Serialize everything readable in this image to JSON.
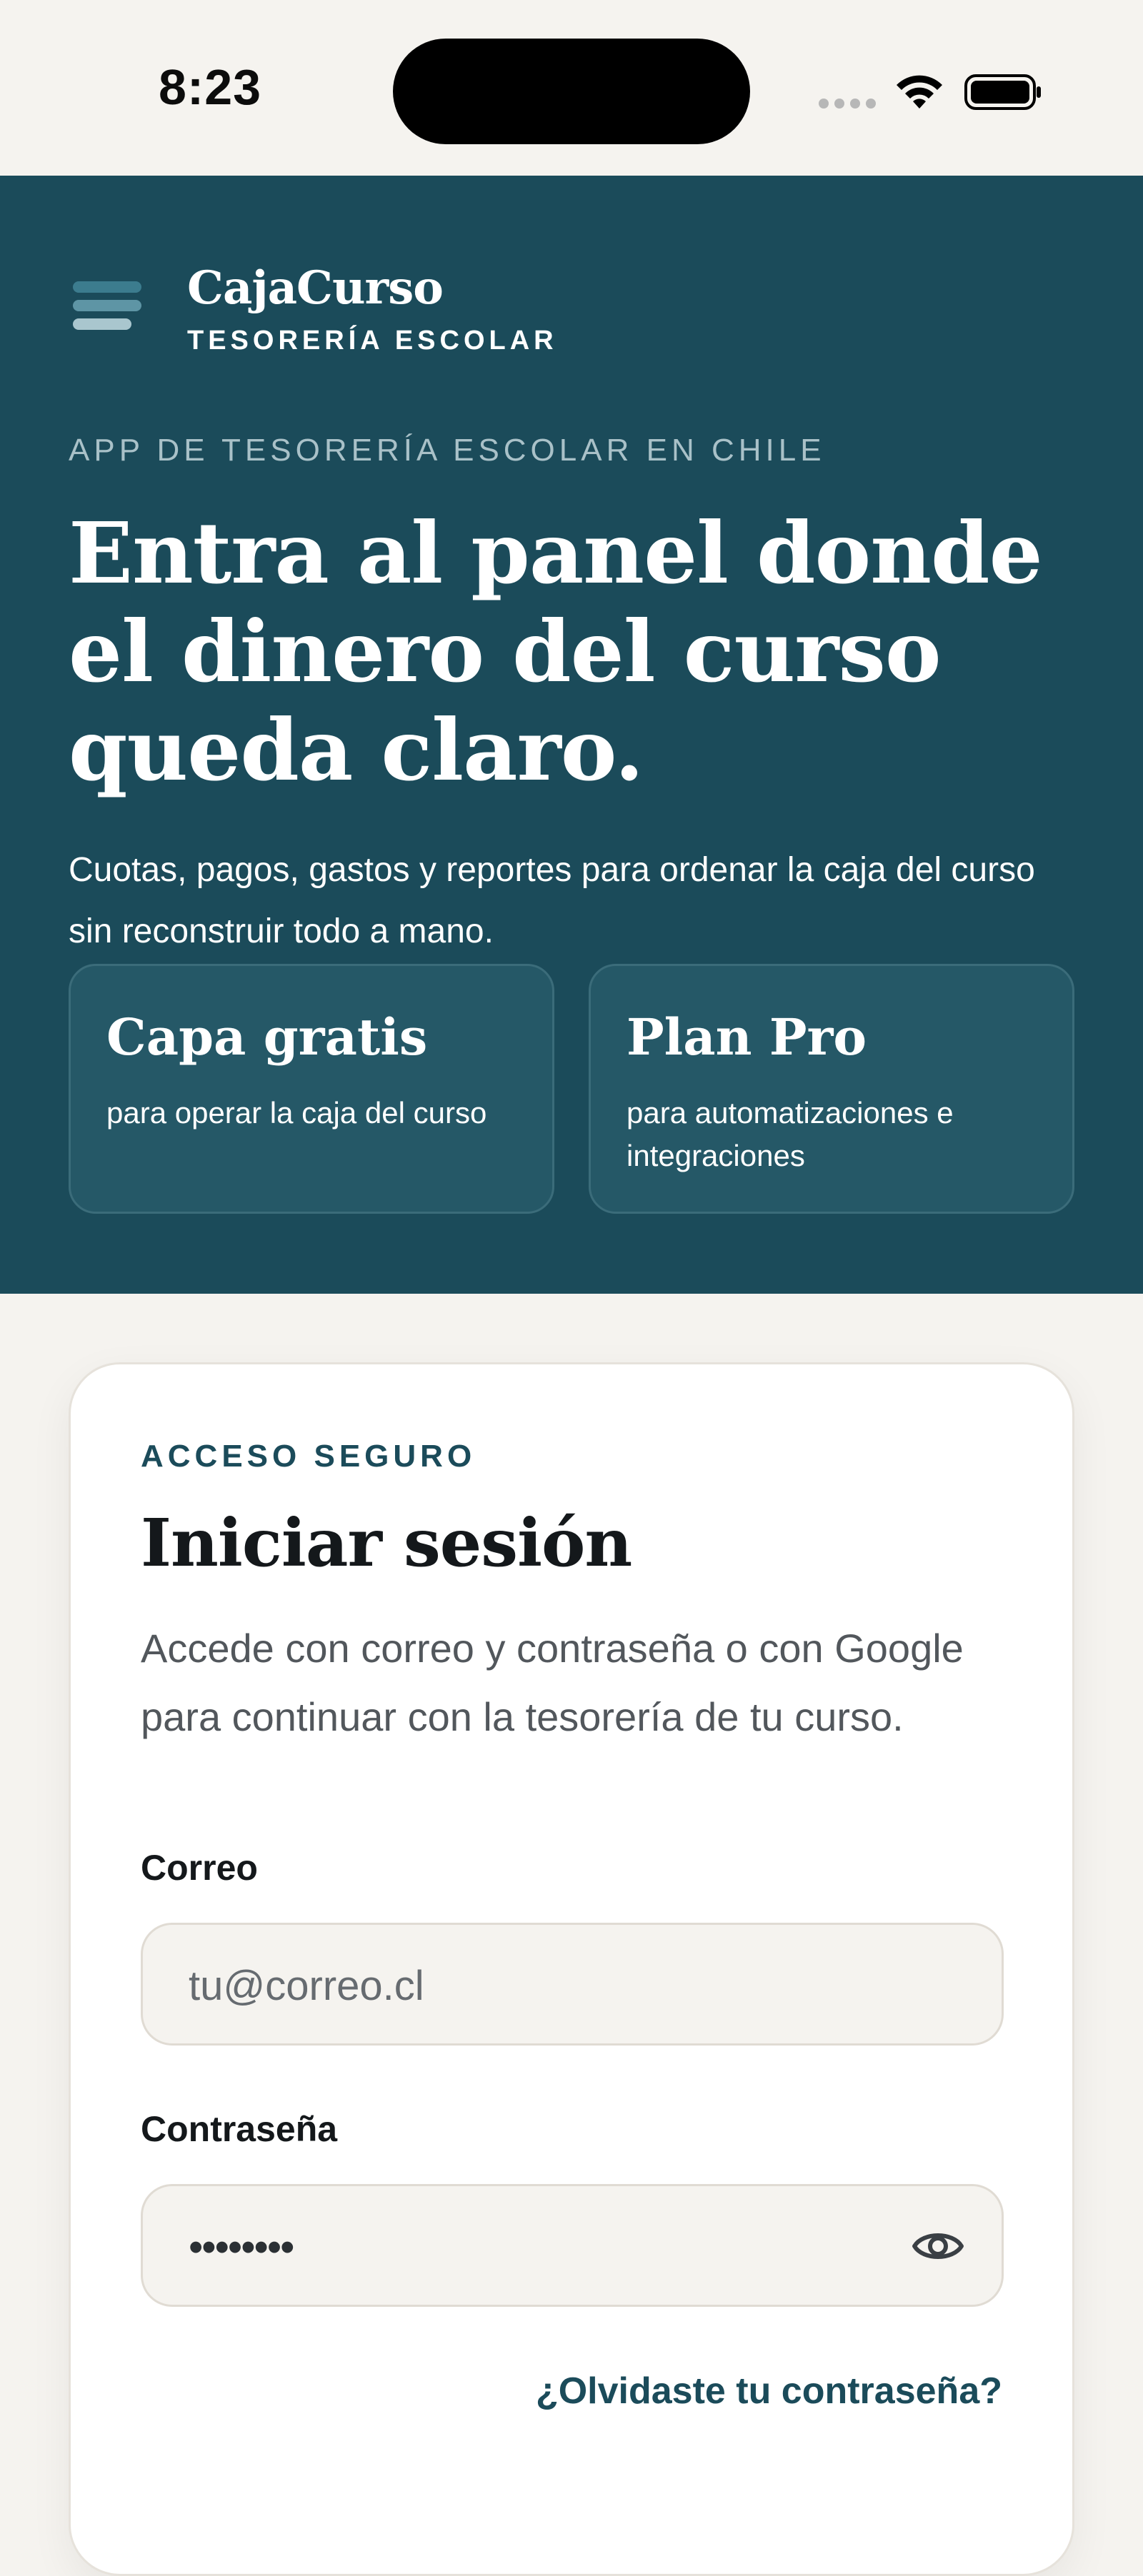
{
  "status_bar": {
    "time": "8:23",
    "icons": [
      "signal-icon",
      "wifi-icon",
      "battery-icon"
    ]
  },
  "colors": {
    "hero_background": "#1b4b5a",
    "accent": "#1b4b5a",
    "page_background": "#f5f3ef",
    "card_background": "#ffffff"
  },
  "header": {
    "brand_name": "CajaCurso",
    "brand_tagline": "TESORERÍA ESCOLAR",
    "menu_icon": "menu-icon"
  },
  "hero": {
    "eyebrow": "APP DE TESORERÍA ESCOLAR EN CHILE",
    "title": "Entra al panel donde el dinero del curso queda claro.",
    "description": "Cuotas, pagos, gastos y reportes para ordenar la caja del curso sin reconstruir todo a mano.",
    "plans": [
      {
        "title": "Capa gratis",
        "subtitle": "para operar la caja del curso"
      },
      {
        "title": "Plan Pro",
        "subtitle": "para automatizaciones e integraciones"
      }
    ]
  },
  "login": {
    "eyebrow": "ACCESO SEGURO",
    "title": "Iniciar sesión",
    "description": "Accede con correo y contraseña o con Google para continuar con la tesorería de tu curso.",
    "email_label": "Correo",
    "email_placeholder": "tu@correo.cl",
    "password_label": "Contraseña",
    "password_value": "••••••••",
    "show_password_icon": "eye-icon",
    "forgot_password": "¿Olvidaste tu contraseña?"
  }
}
